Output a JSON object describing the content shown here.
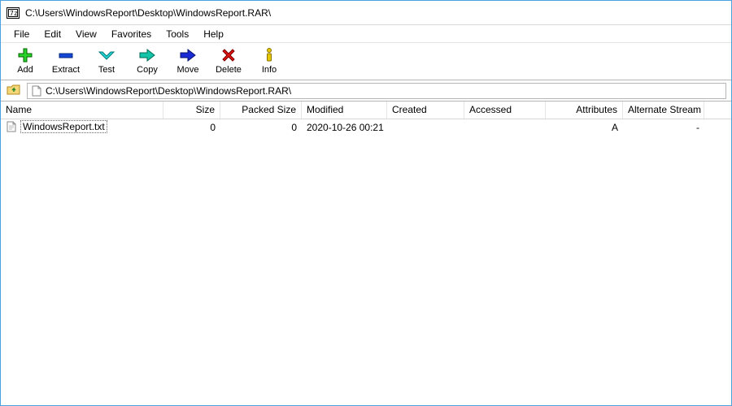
{
  "window": {
    "title": "C:\\Users\\WindowsReport\\Desktop\\WindowsReport.RAR\\"
  },
  "menu": {
    "file": "File",
    "edit": "Edit",
    "view": "View",
    "favorites": "Favorites",
    "tools": "Tools",
    "help": "Help"
  },
  "toolbar": {
    "add": "Add",
    "extract": "Extract",
    "test": "Test",
    "copy": "Copy",
    "move": "Move",
    "delete": "Delete",
    "info": "Info"
  },
  "pathbar": {
    "path": "C:\\Users\\WindowsReport\\Desktop\\WindowsReport.RAR\\"
  },
  "columns": {
    "name": "Name",
    "size": "Size",
    "packed": "Packed Size",
    "modified": "Modified",
    "created": "Created",
    "accessed": "Accessed",
    "attributes": "Attributes",
    "altstream": "Alternate Stream"
  },
  "rows": [
    {
      "name": "WindowsReport.txt",
      "size": "0",
      "packed": "0",
      "modified": "2020-10-26 00:21",
      "created": "",
      "accessed": "",
      "attributes": "A",
      "altstream": "-"
    }
  ]
}
